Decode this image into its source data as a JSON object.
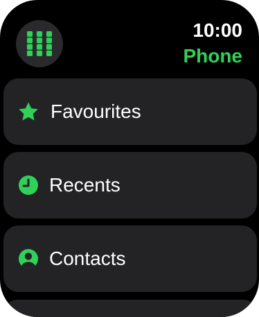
{
  "status": {
    "time": "10:00"
  },
  "header": {
    "app_title": "Phone",
    "keypad_icon": "keypad-grid-icon"
  },
  "menu": {
    "items": [
      {
        "label": "Favourites",
        "icon": "star-icon"
      },
      {
        "label": "Recents",
        "icon": "clock-icon"
      },
      {
        "label": "Contacts",
        "icon": "person-icon"
      }
    ]
  },
  "colors": {
    "accent": "#30d158",
    "background": "#000000",
    "card": "#232325",
    "keypad_button": "#2a2a2c"
  }
}
